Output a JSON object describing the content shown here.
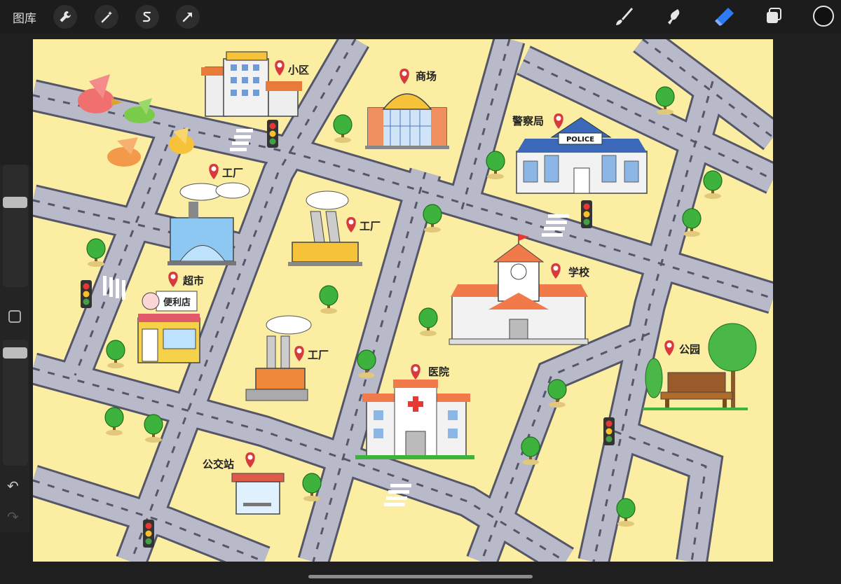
{
  "toolbar": {
    "gallery_label": "图库",
    "left_tools": [
      {
        "name": "actions-wrench-icon"
      },
      {
        "name": "adjustments-wand-icon"
      },
      {
        "name": "selection-s-icon"
      },
      {
        "name": "transform-arrow-icon"
      }
    ],
    "right_tools": [
      {
        "name": "brush-icon"
      },
      {
        "name": "smudge-icon"
      },
      {
        "name": "eraser-icon",
        "active": true
      },
      {
        "name": "layers-icon"
      }
    ],
    "accent_color": "#2f7bf5",
    "current_color": "#111111"
  },
  "map": {
    "labels": {
      "residential": "小区",
      "mall": "商场",
      "police_station": "警察局",
      "police_sign": "POLICE",
      "factory_1": "工厂",
      "factory_2": "工厂",
      "factory_3": "工厂",
      "supermarket": "超市",
      "convenience_store": "便利店",
      "school": "学校",
      "park": "公园",
      "hospital": "医院",
      "bus_stop": "公交站"
    },
    "colors": {
      "background": "#fbeea2",
      "road": "#b9bac9",
      "road_edge": "#55566a",
      "pin": "#d63a3a"
    }
  }
}
